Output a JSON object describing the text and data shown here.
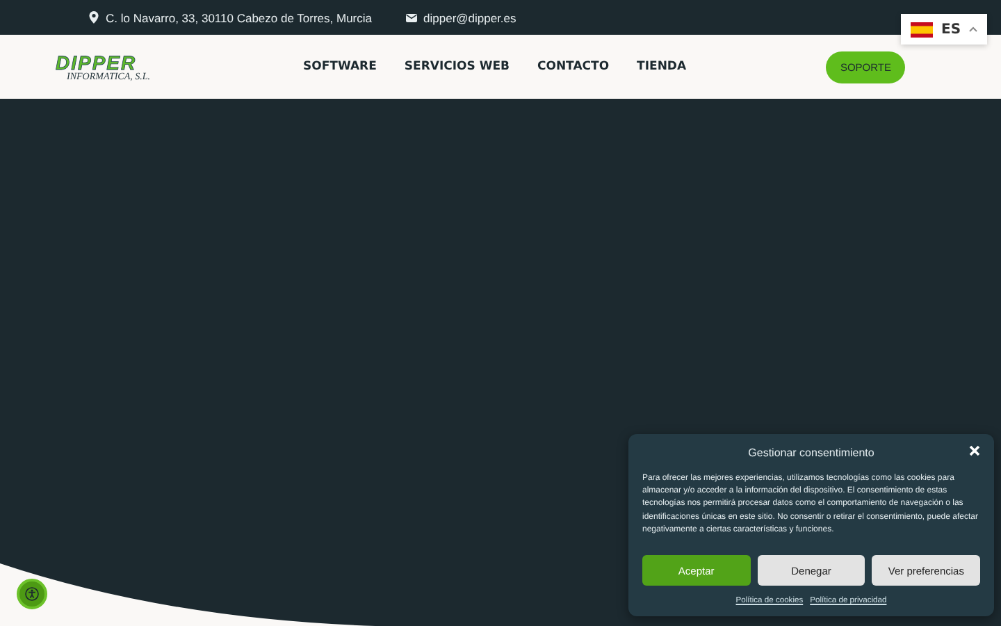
{
  "topbar": {
    "address": "C. lo Navarro, 33, 30110 Cabezo de Torres, Murcia",
    "email": "dipper@dipper.es"
  },
  "language": {
    "code": "ES",
    "expanded": true
  },
  "logo": {
    "name": "DIPPER",
    "subtitle": "INFORMATICA, S.L."
  },
  "nav": [
    "SOFTWARE",
    "SERVICIOS WEB",
    "CONTACTO",
    "TIENDA"
  ],
  "support_button": "SOPORTE",
  "cookie_dialog": {
    "title": "Gestionar consentimiento",
    "text": "Para ofrecer las mejores experiencias, utilizamos tecnologías como las cookies para almacenar y/o acceder a la información del dispositivo. El consentimiento de estas tecnologías nos permitirá procesar datos como el comportamiento de navegación o las identificaciones únicas en este sitio. No consentir o retirar el consentimiento, puede afectar negativamente a ciertas características y funciones.",
    "buttons": [
      {
        "label": "Aceptar",
        "kind": "primary"
      },
      {
        "label": "Denegar",
        "kind": "secondary"
      },
      {
        "label": "Ver preferencias",
        "kind": "secondary"
      }
    ],
    "links": [
      "Política de cookies",
      "Política de privacidad"
    ]
  }
}
